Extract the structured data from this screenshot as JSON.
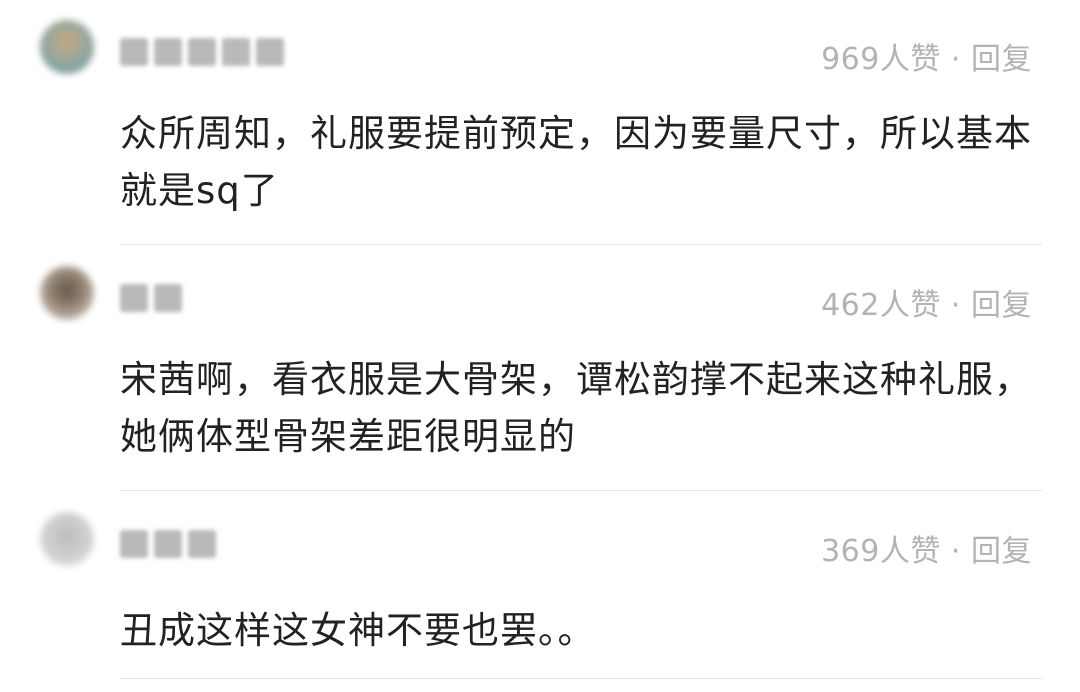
{
  "comments": [
    {
      "likes": "969人赞",
      "separator": "·",
      "reply": "回复",
      "text": "众所周知，礼服要提前预定，因为要量尺寸，所以基本就是sq了",
      "avatar_colors": [
        "#7da0a8",
        "#c9a77e"
      ]
    },
    {
      "likes": "462人赞",
      "separator": "·",
      "reply": "回复",
      "text": "宋茜啊，看衣服是大骨架，谭松韵撑不起来这种礼服，她俩体型骨架差距很明显的",
      "avatar_colors": [
        "#8a7a6a",
        "#d8cfc4"
      ]
    },
    {
      "likes": "369人赞",
      "separator": "·",
      "reply": "回复",
      "text": "丑成这样这女神不要也罢。。",
      "avatar_colors": [
        "#c8c8c8",
        "#e4e4e4"
      ]
    }
  ]
}
